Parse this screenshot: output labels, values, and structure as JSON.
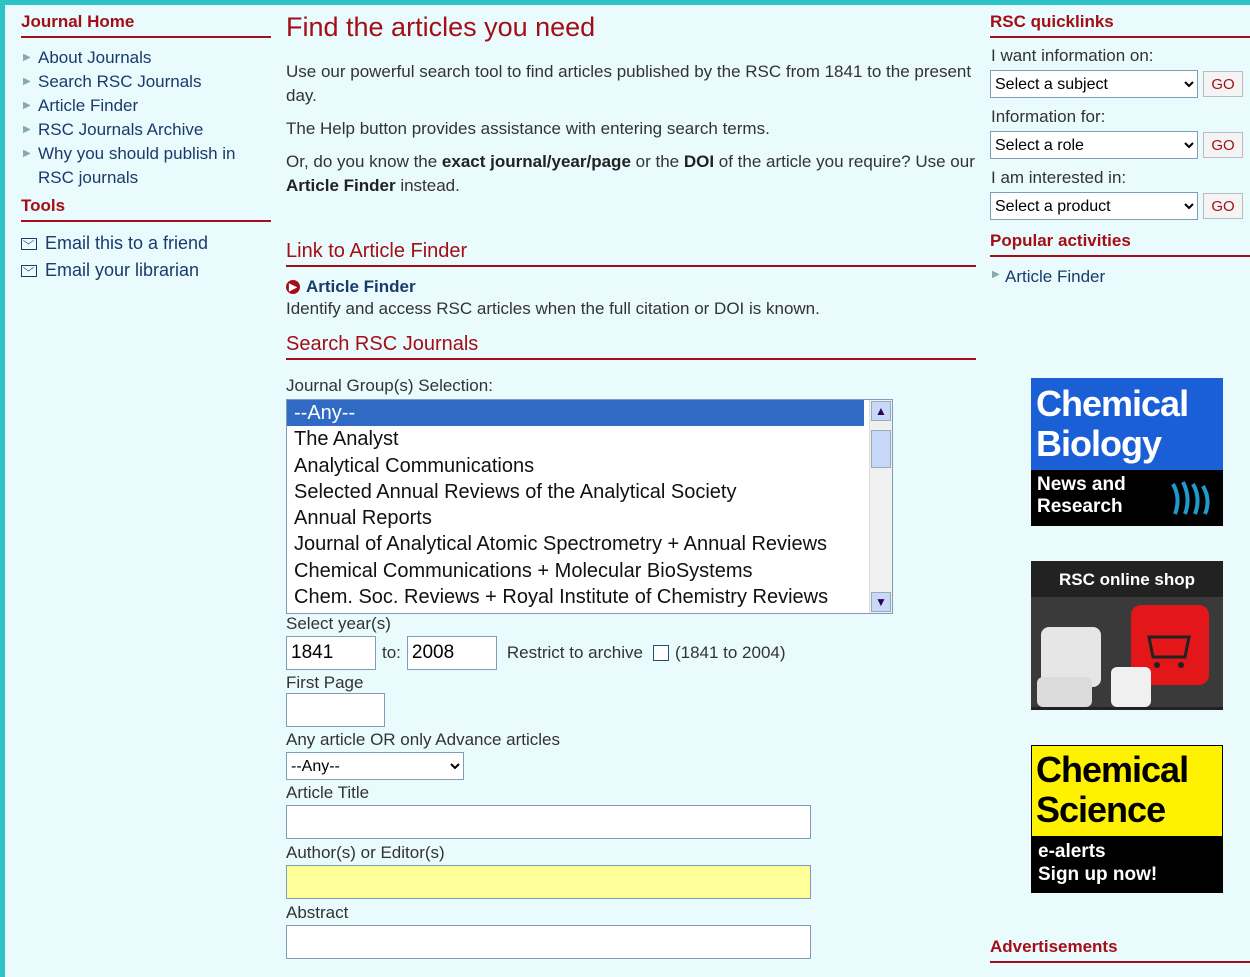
{
  "left": {
    "home_title": "Journal Home",
    "nav": [
      "About Journals",
      "Search RSC Journals",
      "Article Finder",
      "RSC Journals Archive",
      "Why you should publish in RSC journals"
    ],
    "tools_title": "Tools",
    "tools": [
      "Email this to a friend",
      "Email your librarian"
    ]
  },
  "main": {
    "title": "Find the articles you need",
    "intro1": "Use our powerful search tool to find articles published by the RSC from 1841 to the present day.",
    "intro2": "The Help button provides assistance with entering search terms.",
    "intro3_a": "Or, do you know the ",
    "intro3_b": "exact journal/year/page",
    "intro3_c": " or the ",
    "intro3_d": "DOI",
    "intro3_e": " of the article you require? Use our ",
    "intro3_f": "Article Finder",
    "intro3_g": " instead.",
    "link_heading": "Link to Article Finder",
    "af_link": "Article Finder",
    "af_desc": "Identify and access RSC articles when the full citation or DOI is known.",
    "search_heading": "Search RSC Journals",
    "group_label": "Journal Group(s) Selection:",
    "groups": [
      "--Any--",
      "The Analyst",
      "Analytical Communications",
      "Selected Annual Reviews of the Analytical Society",
      "Annual Reports",
      "Journal of Analytical Atomic Spectrometry + Annual Reviews",
      "Chemical Communications + Molecular BioSystems",
      "Chem. Soc. Reviews + Royal Institute of Chemistry Reviews"
    ],
    "year_label": "Select year(s)",
    "year_from": "1841",
    "to_label": "to:",
    "year_to": "2008",
    "restrict_label": "Restrict to archive",
    "restrict_range": "(1841 to 2004)",
    "first_page_label": "First Page",
    "advance_label": "Any article OR only Advance articles",
    "advance_value": "--Any--",
    "title_label": "Article Title",
    "author_label": "Author(s) or Editor(s)",
    "abstract_label": "Abstract"
  },
  "right": {
    "quick_title": "RSC quicklinks",
    "info_on_label": "I want information on:",
    "subject_value": "Select a subject",
    "info_for_label": "Information for:",
    "role_value": "Select a role",
    "interest_label": "I am interested in:",
    "product_value": "Select a product",
    "go": "GO",
    "popular_title": "Popular activities",
    "popular_item": "Article Finder",
    "ads_title": "Advertisements",
    "ad1_big": "Chemical Biology",
    "ad1_small1": "News and",
    "ad1_small2": "Research",
    "ad2_title": "RSC online shop",
    "ad3_big1": "Chemical",
    "ad3_big2": "Science",
    "ad3_small1": "e-alerts",
    "ad3_small2": "Sign up now!"
  },
  "colors": {
    "accent": "#a40e16",
    "link": "#1a3a6b",
    "page_bg": "#e9fbfd",
    "frame": "#2bc3c8",
    "selected": "#316ac5",
    "highlight_input": "#ffff99"
  }
}
